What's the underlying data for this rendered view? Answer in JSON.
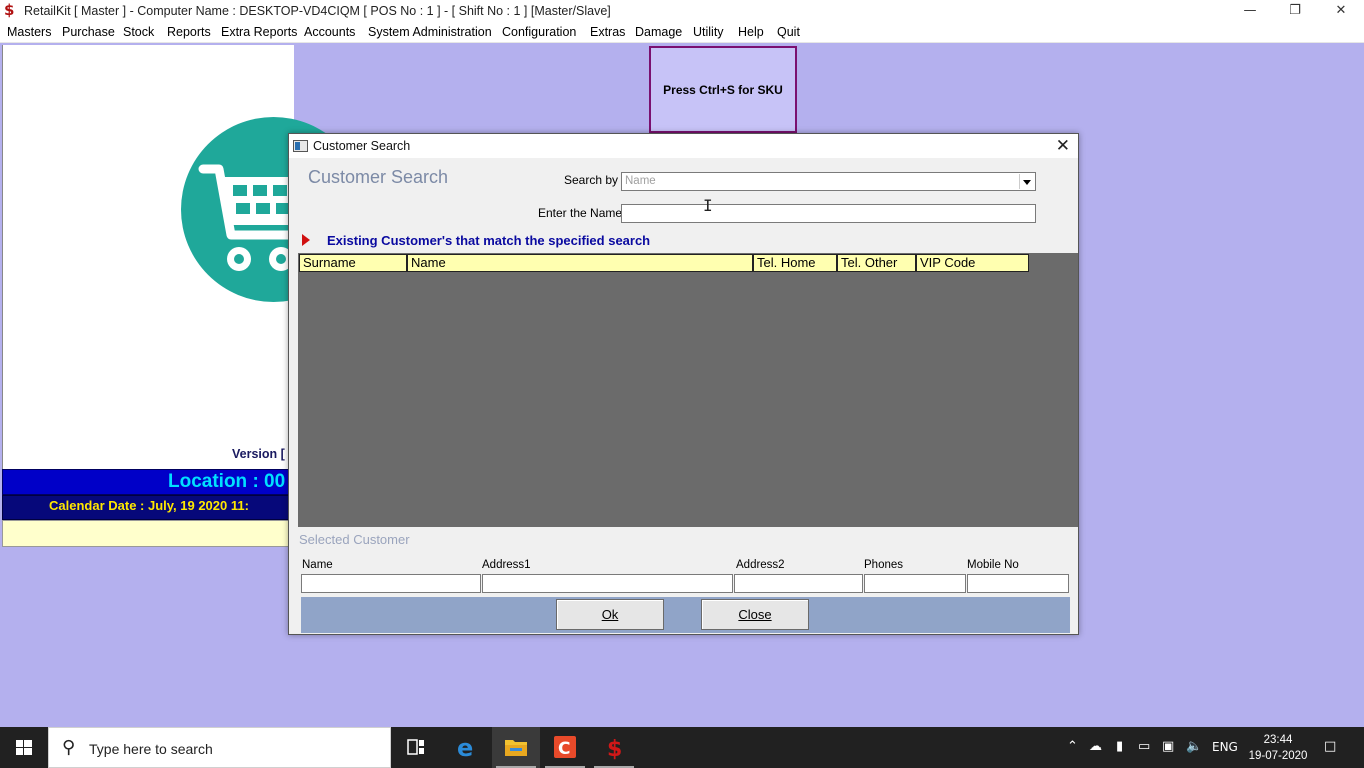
{
  "window": {
    "title": "RetailKit [ Master ] - Computer Name : DESKTOP-VD4CIQM [ POS No : 1 ] - [ Shift No : 1 ]  [Master/Slave]",
    "app_icon_glyph": "$"
  },
  "menu": [
    "Masters",
    "Purchase",
    "Stock",
    "Reports",
    "Extra Reports",
    "Accounts",
    "System Administration",
    "Configuration",
    "Extras",
    "Damage",
    "Utility",
    "Help",
    "Quit"
  ],
  "main": {
    "sku_hint": "Press Ctrl+S for SKU",
    "version_label": "Version [",
    "location_text": "Location : 00",
    "calendar_text": "Calendar Date : July, 19 2020 11:"
  },
  "dialog": {
    "title": "Customer Search",
    "heading": "Customer Search",
    "search_by_label": "Search by",
    "search_by_value": "Name",
    "enter_name_label": "Enter the Name",
    "enter_name_value": "",
    "results_label": "Existing  Customer's that match the specified search",
    "grid_columns": [
      "Surname",
      "Name",
      "Tel. Home",
      "Tel. Other",
      "VIP Code"
    ],
    "grid_rows": [],
    "selected_heading": "Selected  Customer",
    "selected_fields": {
      "name_label": "Name",
      "address1_label": "Address1",
      "address2_label": "Address2",
      "phones_label": "Phones",
      "mobile_label": "Mobile No"
    },
    "ok_label": "Ok",
    "close_label": "Close"
  },
  "taskbar": {
    "search_placeholder": "Type here to search",
    "language": "ENG",
    "time": "23:44",
    "date": "19-07-2020"
  },
  "colors": {
    "client_bg": "#b4b0ee",
    "location_bar": "#0000c8",
    "location_text": "#00e0ff",
    "calendar_text": "#ffe800",
    "grid_header": "#ffffb0",
    "grid_bg": "#6b6b6b",
    "button_bar": "#90a4c8",
    "cart_logo": "#1fa89a"
  }
}
